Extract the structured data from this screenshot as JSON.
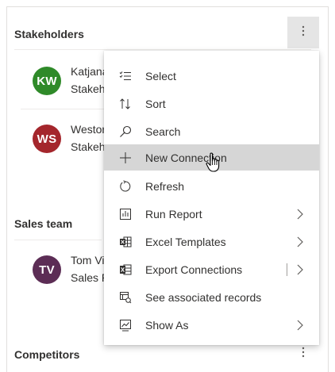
{
  "sections": {
    "stakeholders": {
      "title": "Stakeholders"
    },
    "sales_team": {
      "title": "Sales team"
    },
    "competitors": {
      "title": "Competitors"
    }
  },
  "contacts": [
    {
      "initials": "KW",
      "name": "Katjana",
      "role": "Stakeho",
      "color": "#2f8a29"
    },
    {
      "initials": "WS",
      "name": "Westor",
      "role": "Stakeho",
      "color": "#a4262c"
    },
    {
      "initials": "TV",
      "name": "Tom Vi",
      "role": "Sales P",
      "color": "#5c2d55"
    }
  ],
  "more_icon": "more-vertical-icon",
  "menu": {
    "items": [
      {
        "label": "Select",
        "icon": "multi-select-icon"
      },
      {
        "label": "Sort",
        "icon": "sort-icon"
      },
      {
        "label": "Search",
        "icon": "search-icon"
      },
      {
        "label": "New Connection",
        "icon": "add-icon",
        "hovered": true
      },
      {
        "label": "Refresh",
        "icon": "refresh-icon"
      },
      {
        "label": "Run Report",
        "icon": "report-icon",
        "submenu": true
      },
      {
        "label": "Excel Templates",
        "icon": "excel-icon",
        "submenu": true
      },
      {
        "label": "Export Connections",
        "icon": "export-excel-icon",
        "submenu": true,
        "split": true
      },
      {
        "label": "See associated records",
        "icon": "associated-records-icon"
      },
      {
        "label": "Show As",
        "icon": "show-as-icon",
        "submenu": true
      }
    ]
  }
}
